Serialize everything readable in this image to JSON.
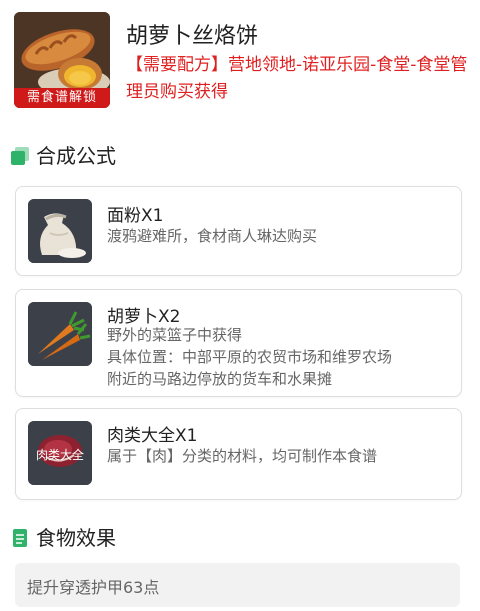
{
  "recipe": {
    "title": "胡萝卜丝烙饼",
    "source": "【需要配方】营地领地-诺亚乐园-食堂-食堂管理员购买获得",
    "badge": "需食谱解锁",
    "image_icon": "bread-icon"
  },
  "sections": {
    "formula_title": "合成公式",
    "effect_title": "食物效果",
    "formula_icon": "green-square-icon",
    "effect_icon": "green-document-icon"
  },
  "ingredients": [
    {
      "name": "面粉X1",
      "lines": [
        "渡鸦避难所，食材商人琳达购买"
      ],
      "icon": "flour-sack-icon"
    },
    {
      "name": "胡萝卜X2",
      "lines": [
        "野外的菜篮子中获得",
        "具体位置：中部平原的农贸市场和维罗农场",
        "附近的马路边停放的货车和水果摊"
      ],
      "icon": "carrot-icon"
    },
    {
      "name": "肉类大全X1",
      "lines": [
        "属于【肉】分类的材料，均可制作本食谱"
      ],
      "icon": "meat-icon",
      "icon_text": "肉类大全"
    }
  ],
  "effect": {
    "text": "提升穿透护甲63点"
  },
  "colors": {
    "accent_green": "#2fb36a",
    "source_red": "#e02020",
    "badge_red": "#d01a1a"
  }
}
